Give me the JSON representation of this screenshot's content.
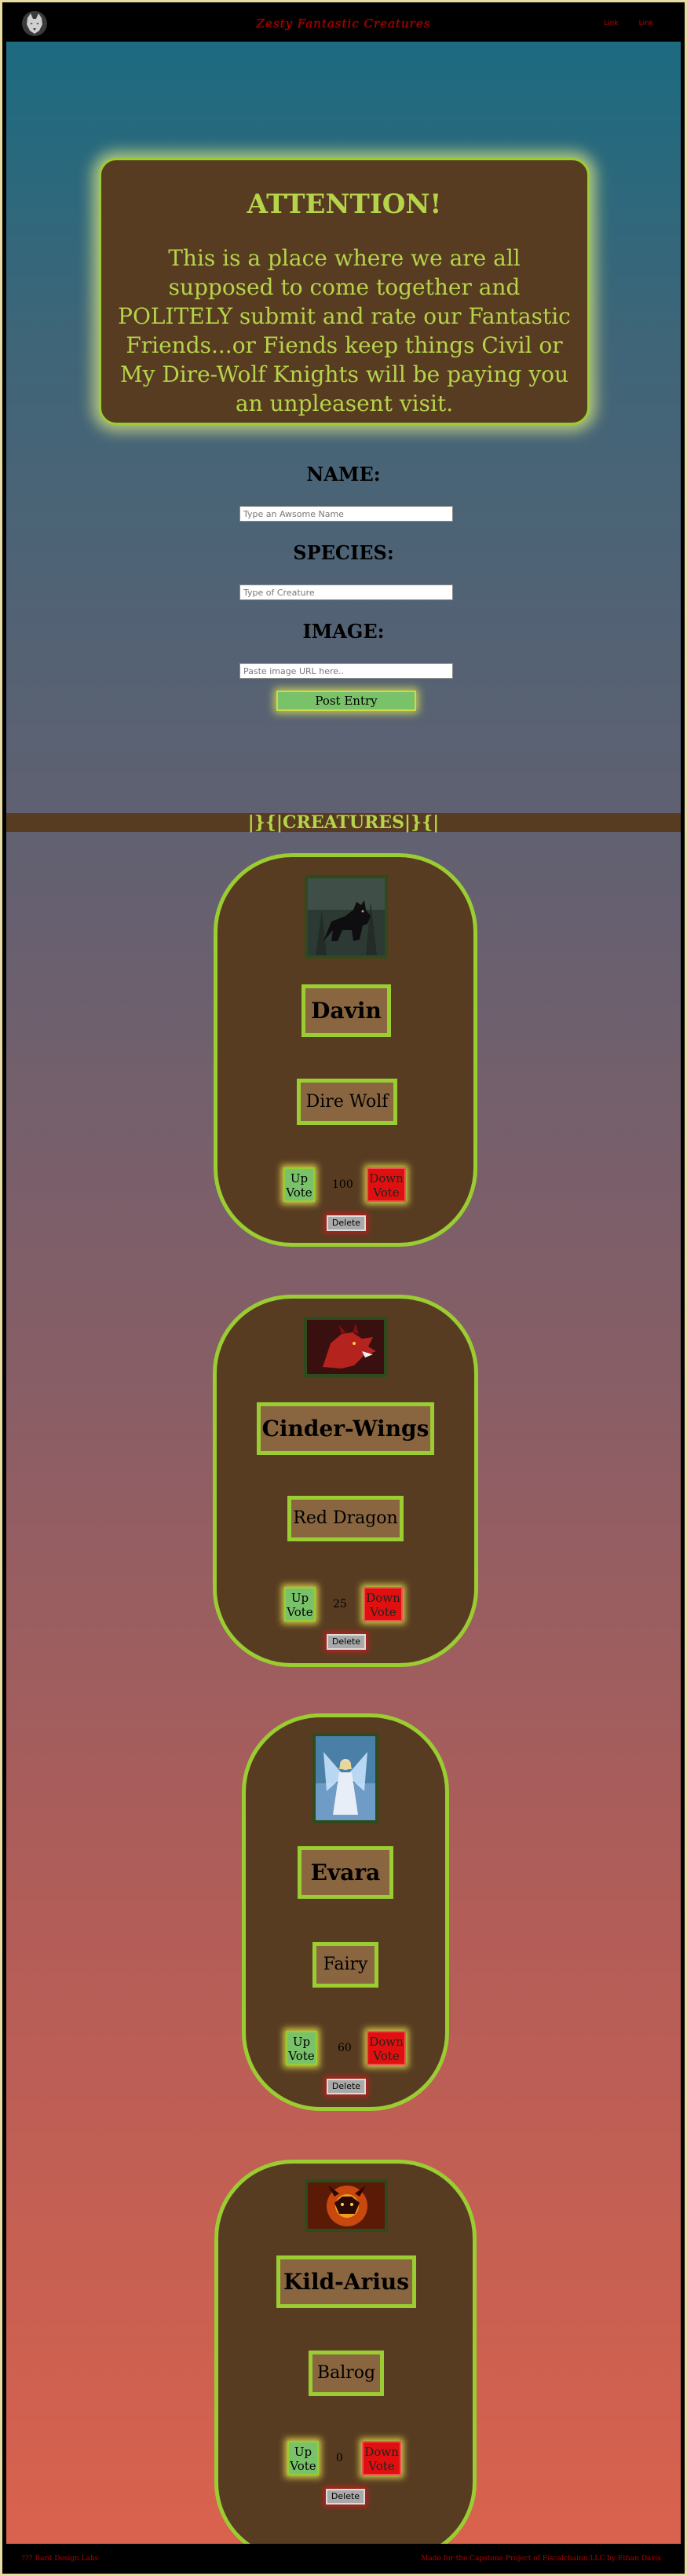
{
  "header": {
    "logo_icon": "wolf-icon",
    "site_title": "Zesty Fantastic Creatures",
    "nav": [
      "Link",
      "Link"
    ]
  },
  "attention": {
    "title": "ATTENTION!",
    "message": "This is a place where we are all supposed to come together and POLITELY submit and rate our Fantastic Friends...or Fiends keep things Civil or My Dire-Wolf Knights will be paying you an unpleasent visit."
  },
  "form": {
    "name_label": "NAME:",
    "name_placeholder": "Type an Awsome Name",
    "species_label": "SPECIES:",
    "species_placeholder": "Type of Creature",
    "image_label": "IMAGE:",
    "image_placeholder": "Paste image URL here..",
    "submit_label": "Post Entry"
  },
  "section_title": "|}{|CREATURES|}{|",
  "creatures": [
    {
      "name": "Davin",
      "species": "Dire Wolf",
      "votes": "100",
      "image": "black-wolf-image"
    },
    {
      "name": "Cinder-Wings",
      "species": "Red Dragon",
      "votes": "25",
      "image": "red-dragon-image"
    },
    {
      "name": "Evara",
      "species": "Fairy",
      "votes": "60",
      "image": "fairy-image"
    },
    {
      "name": "Kild-Arius",
      "species": "Balrog",
      "votes": "0",
      "image": "balrog-image"
    }
  ],
  "card_buttons": {
    "up": "Up Vote",
    "down": "Down Vote",
    "delete": "Delete"
  },
  "footer": {
    "left": "??? Bard Design Labs",
    "right": "Made for the Capstone Project of Fiscalchainn LLC by Ethan Davis"
  },
  "colors": {
    "accent": "#9acd32",
    "panel": "#583c22",
    "link": "#c00000",
    "up_button": "#79c26a",
    "down_button": "#e01010"
  }
}
